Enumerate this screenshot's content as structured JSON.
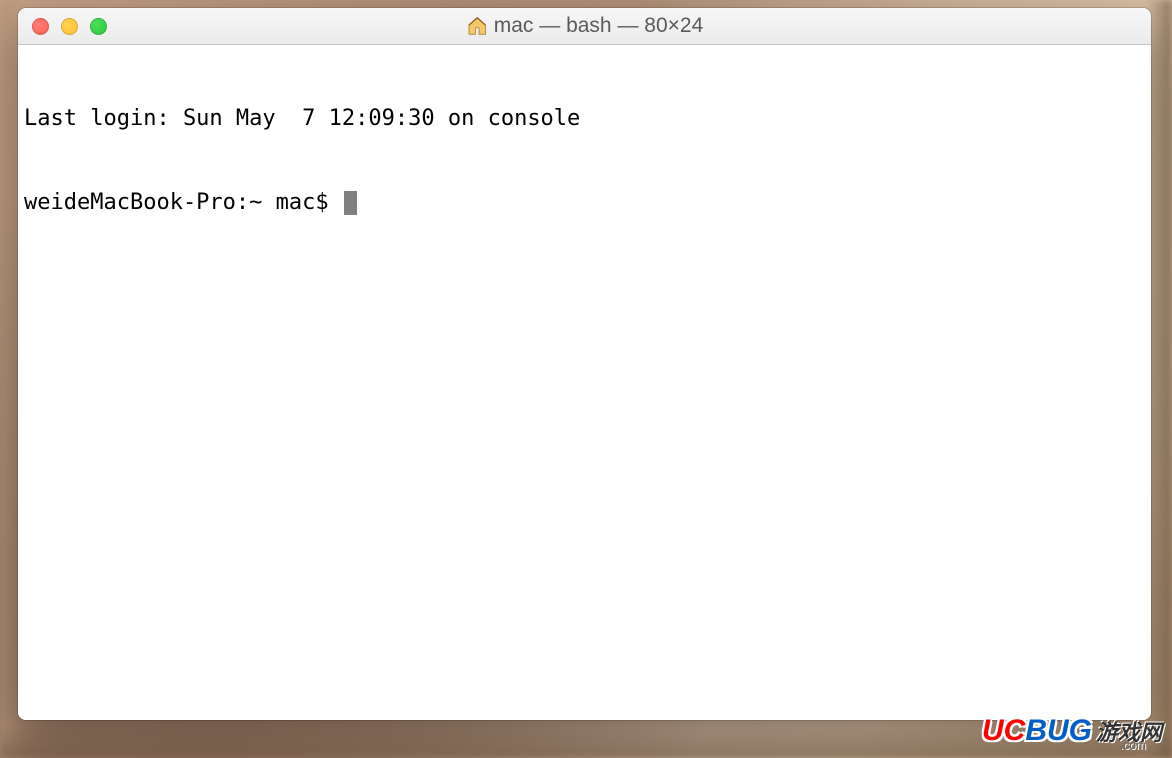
{
  "window": {
    "title": "mac — bash — 80×24",
    "icon": "home-icon"
  },
  "terminal": {
    "last_login_line": "Last login: Sun May  7 12:09:30 on console",
    "prompt": "weideMacBook-Pro:~ mac$ "
  },
  "watermark": {
    "text_uc": "UC",
    "text_bug": "BUG",
    "text_cn": "游戏网",
    "text_sub": ".com"
  }
}
